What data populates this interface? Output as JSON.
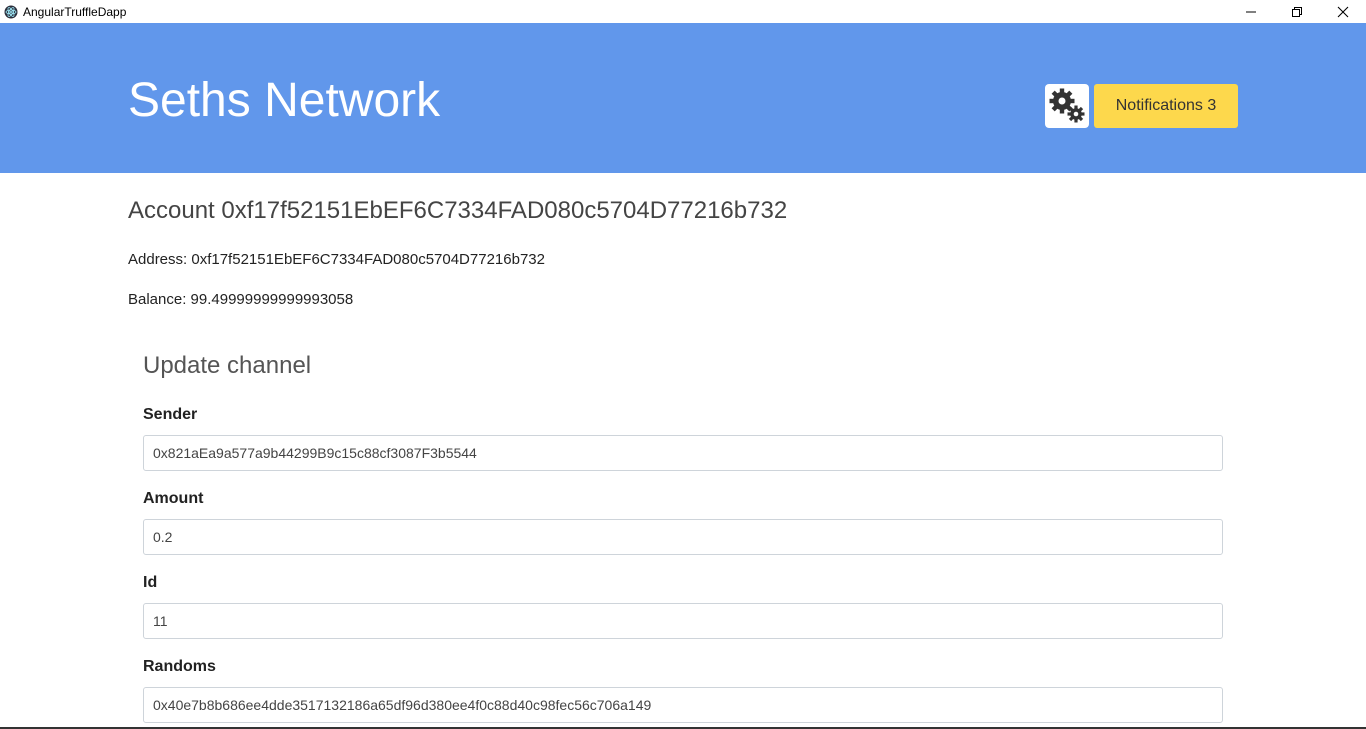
{
  "window": {
    "title": "AngularTruffleDapp",
    "app_icon": "electron-atom-icon",
    "controls": [
      "minimize-icon",
      "restore-icon",
      "close-icon"
    ]
  },
  "header": {
    "brand": "Seths Network",
    "background_color": "#6197eb",
    "settings_icon": "gears-icon",
    "notifications_label": "Notifications 3",
    "notifications_color": "#fdd84c"
  },
  "account": {
    "title": "Account 0xf17f52151EbEF6C7334FAD080c5704D77216b732",
    "address_line": "Address: 0xf17f52151EbEF6C7334FAD080c5704D77216b732",
    "balance_line": "Balance: 99.49999999999993058"
  },
  "form": {
    "title": "Update channel",
    "fields": [
      {
        "label": "Sender",
        "value": "0x821aEa9a577a9b44299B9c15c88cf3087F3b5544"
      },
      {
        "label": "Amount",
        "value": "0.2"
      },
      {
        "label": "Id",
        "value": "11"
      },
      {
        "label": "Randoms",
        "value": "0x40e7b8b686ee4dde3517132186a65df96d380ee4f0c88d40c98fec56c706a149"
      }
    ]
  }
}
